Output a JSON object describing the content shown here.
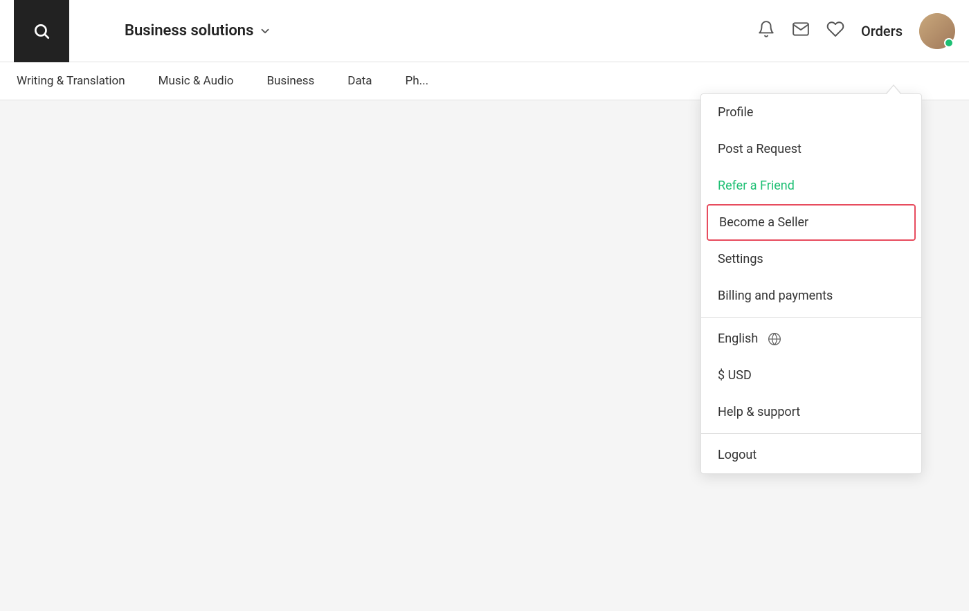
{
  "header": {
    "business_solutions_label": "Business solutions",
    "orders_label": "Orders",
    "online_status": "online"
  },
  "nav": {
    "items": [
      {
        "label": "Writing & Translation"
      },
      {
        "label": "Music & Audio"
      },
      {
        "label": "Business"
      },
      {
        "label": "Data"
      },
      {
        "label": "Ph..."
      }
    ]
  },
  "dropdown": {
    "items": [
      {
        "id": "profile",
        "label": "Profile",
        "type": "normal",
        "divider_after": false
      },
      {
        "id": "post-request",
        "label": "Post a Request",
        "type": "normal",
        "divider_after": false
      },
      {
        "id": "refer-friend",
        "label": "Refer a Friend",
        "type": "green",
        "divider_after": false
      },
      {
        "id": "become-seller",
        "label": "Become a Seller",
        "type": "highlighted",
        "divider_after": false
      },
      {
        "id": "settings",
        "label": "Settings",
        "type": "normal",
        "divider_after": false
      },
      {
        "id": "billing",
        "label": "Billing and payments",
        "type": "normal",
        "divider_after": true
      },
      {
        "id": "english",
        "label": "English",
        "type": "normal",
        "has_globe": true,
        "divider_after": false
      },
      {
        "id": "usd",
        "label": "$ USD",
        "type": "normal",
        "divider_after": false
      },
      {
        "id": "help",
        "label": "Help & support",
        "type": "normal",
        "divider_after": true
      },
      {
        "id": "logout",
        "label": "Logout",
        "type": "normal",
        "divider_after": false
      }
    ]
  },
  "icons": {
    "search": "🔍",
    "bell": "🔔",
    "mail": "✉",
    "heart": "♡",
    "chevron_down": "▾",
    "globe": "🌐"
  }
}
